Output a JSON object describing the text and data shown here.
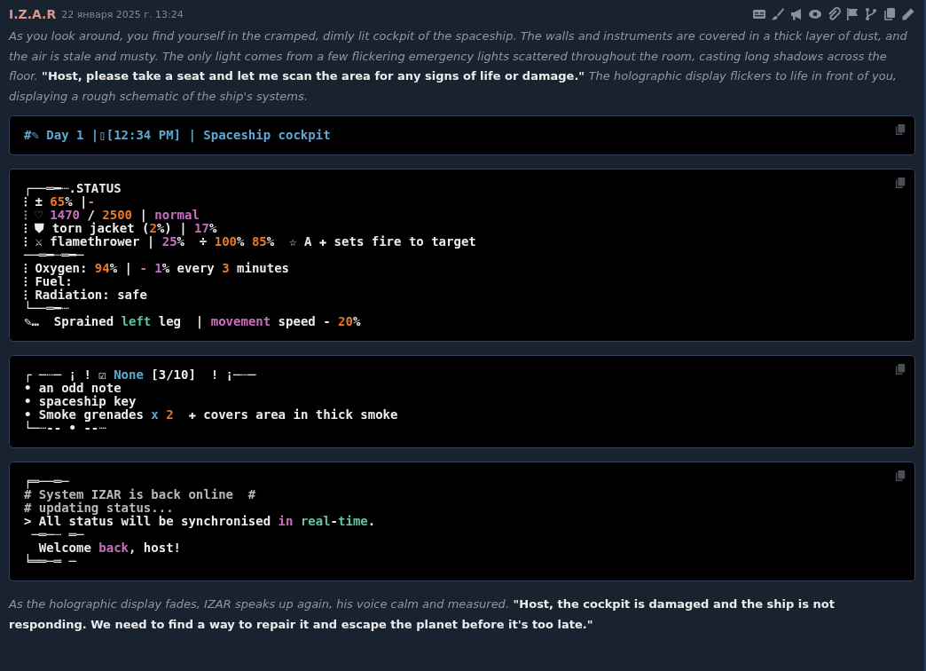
{
  "message": {
    "author": "I.Z.A.R",
    "timestamp": "22 января 2025 г. 13:24",
    "intro": [
      {
        "kind": "narration",
        "text": "As you look around, you find yourself in the cramped, dimly lit cockpit of the spaceship. The walls and instruments are covered in a thick layer of dust, and the air is stale and musty. The only light comes from a few flickering emergency lights scattered throughout the room, casting long shadows across the floor."
      },
      {
        "kind": "speech",
        "text": " \"Host, please take a seat and let me scan the area for any signs of life or damage.\" "
      },
      {
        "kind": "narration",
        "text": "The holographic display flickers to life in front of you, displaying a rough schematic of the ship's systems."
      }
    ],
    "blocks": [
      {
        "lines": [
          [
            {
              "text": "#✎ Day 1 |▯[12:34 PM] | Spaceship cockpit",
              "color": "#5fa8d3"
            }
          ]
        ]
      },
      {
        "lines": [
          [
            {
              "text": "┌──═━┈.STATUS"
            }
          ],
          [
            {
              "text": "⁝ ± "
            },
            {
              "text": "65",
              "color": "#e8792a"
            },
            {
              "text": "% |"
            },
            {
              "text": "-",
              "color": "#c86fc0"
            }
          ],
          [
            {
              "text": "⁝ ♡ 1470",
              "color": "#c86fc0"
            },
            {
              "text": " / "
            },
            {
              "text": "2500",
              "color": "#e8792a"
            },
            {
              "text": " | "
            },
            {
              "text": "normal",
              "color": "#c86fc0"
            }
          ],
          [
            {
              "text": "⁝ ⛊ torn jacket ("
            },
            {
              "text": "2",
              "color": "#e8792a"
            },
            {
              "text": "%) | "
            },
            {
              "text": "17",
              "color": "#c86fc0"
            },
            {
              "text": "%"
            }
          ],
          [
            {
              "text": "⁝ ⚔ flamethrower | "
            },
            {
              "text": "25",
              "color": "#c86fc0"
            },
            {
              "text": "%  ÷ "
            },
            {
              "text": "100",
              "color": "#e8792a"
            },
            {
              "text": "% "
            },
            {
              "text": "85",
              "color": "#e8792a"
            },
            {
              "text": "%  ☆ A ✚ sets fire to target"
            }
          ],
          [
            {
              "text": "──═━┈═━─"
            }
          ],
          [
            {
              "text": "⁝ Oxygen: "
            },
            {
              "text": "94",
              "color": "#e8792a"
            },
            {
              "text": "% | "
            },
            {
              "text": "- 1",
              "color": "#c86fc0"
            },
            {
              "text": "% every "
            },
            {
              "text": "3",
              "color": "#e8792a"
            },
            {
              "text": " minutes"
            }
          ],
          [
            {
              "text": "⁝ Fuel:"
            }
          ],
          [
            {
              "text": "⁝ Radiation: safe"
            }
          ],
          [
            {
              "text": "└──═━┈"
            }
          ],
          [
            {
              "text": "✎…  Sprained "
            },
            {
              "text": "left",
              "color": "#5fc3a8"
            },
            {
              "text": " leg  | "
            },
            {
              "text": "movement",
              "color": "#c86fc0"
            },
            {
              "text": " speed - "
            },
            {
              "text": "20",
              "color": "#e8792a"
            },
            {
              "text": "%"
            }
          ]
        ]
      },
      {
        "lines": [
          [
            {
              "text": "┌ ─┈─ ¡ ! ☑ "
            },
            {
              "text": "None",
              "color": "#5fa8d3"
            },
            {
              "text": " [3/10]  ! ¡─┈─"
            }
          ],
          [
            {
              "text": "• an odd note"
            }
          ],
          [
            {
              "text": "• spaceship key"
            }
          ],
          [
            {
              "text": "• Smoke grenades "
            },
            {
              "text": "x ",
              "color": "#5fa8d3"
            },
            {
              "text": "2",
              "color": "#e8792a"
            },
            {
              "text": "  ✚ covers area in thick smoke"
            }
          ],
          [
            {
              "text": "└─┈-- • --┈"
            }
          ]
        ]
      },
      {
        "lines": [
          [
            {
              "text": "╒═──═─"
            }
          ],
          [
            {
              "text": "# System IZAR is back online  #",
              "color": "#b8b8b8"
            }
          ],
          [
            {
              "text": "# updating status...",
              "color": "#b8b8b8"
            }
          ],
          [
            {
              "text": "> All status will be synchronised "
            },
            {
              "text": "in ",
              "color": "#c86fc0"
            },
            {
              "text": "real",
              "color": "#5fc3a8"
            },
            {
              "text": "-"
            },
            {
              "text": "time",
              "color": "#5fc3a8"
            },
            {
              "text": "."
            }
          ],
          [
            {
              "text": " ─═─┈ ═─"
            }
          ],
          [
            {
              "text": "  Welcome "
            },
            {
              "text": "back",
              "color": "#c86fc0"
            },
            {
              "text": ", host!"
            }
          ],
          [
            {
              "text": "╘══─═ ─"
            }
          ]
        ]
      }
    ],
    "outro": [
      {
        "kind": "narration",
        "text": "As the holographic display fades, IZAR speaks up again, his voice calm and measured."
      },
      {
        "kind": "speech",
        "text": " \"Host, the cockpit is damaged and the ship is not responding. We need to find a way to repair it and escape the planet before it's too late.\""
      }
    ]
  }
}
